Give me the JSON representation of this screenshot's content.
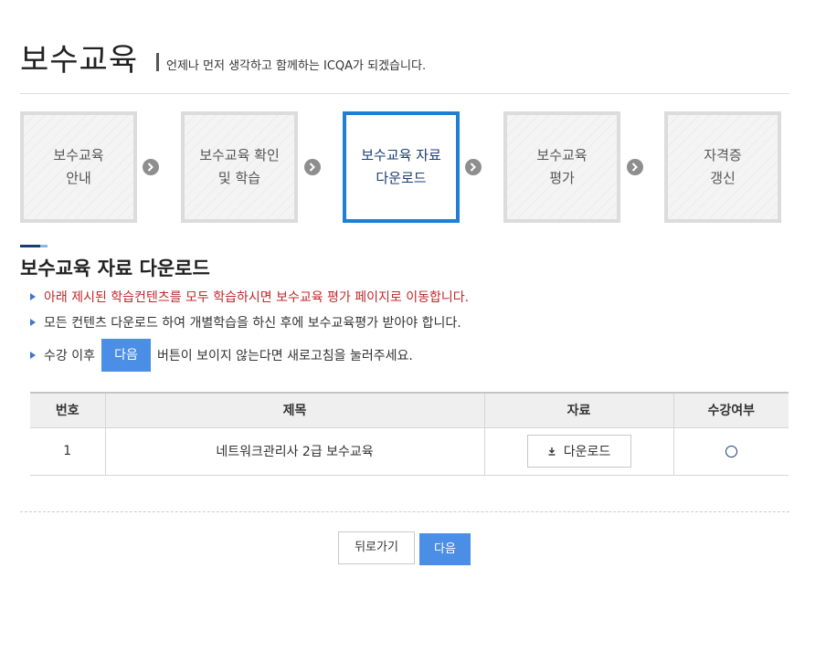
{
  "header": {
    "title": "보수교육",
    "subtitle": "언제나 먼저 생각하고 함께하는 ICQA가 되겠습니다."
  },
  "steps": [
    {
      "label": "보수교육\n안내",
      "active": false
    },
    {
      "label": "보수교육 확인\n및 학습",
      "active": false
    },
    {
      "label": "보수교육 자료\n다운로드",
      "active": true
    },
    {
      "label": "보수교육\n평가",
      "active": false
    },
    {
      "label": "자격증\n갱신",
      "active": false
    }
  ],
  "section": {
    "title": "보수교육 자료 다운로드"
  },
  "notes": {
    "line1": "아래 제시된 학습컨텐츠를 모두 학습하시면 보수교육 평가 페이지로 이동합니다.",
    "line2": "모든 컨텐츠 다운로드 하여 개별학습을 하신 후에 보수교육평가 받아야 합니다.",
    "line3_before": "수강 이후",
    "line3_button": "다음",
    "line3_after": "버튼이 보이지 않는다면 새로고침을 눌러주세요."
  },
  "table": {
    "headers": [
      "번호",
      "제목",
      "자료",
      "수강여부"
    ],
    "rows": [
      {
        "no": "1",
        "title": "네트워크관리사 2급 보수교육",
        "download_label": "다운로드",
        "status": "○"
      }
    ]
  },
  "footer": {
    "back_label": "뒤로가기",
    "next_label": "다음"
  },
  "colors": {
    "accent": "#4a8ee6",
    "active_border": "#1f7fd4",
    "notice_red": "#c0282c",
    "navy": "#1a3d73"
  }
}
